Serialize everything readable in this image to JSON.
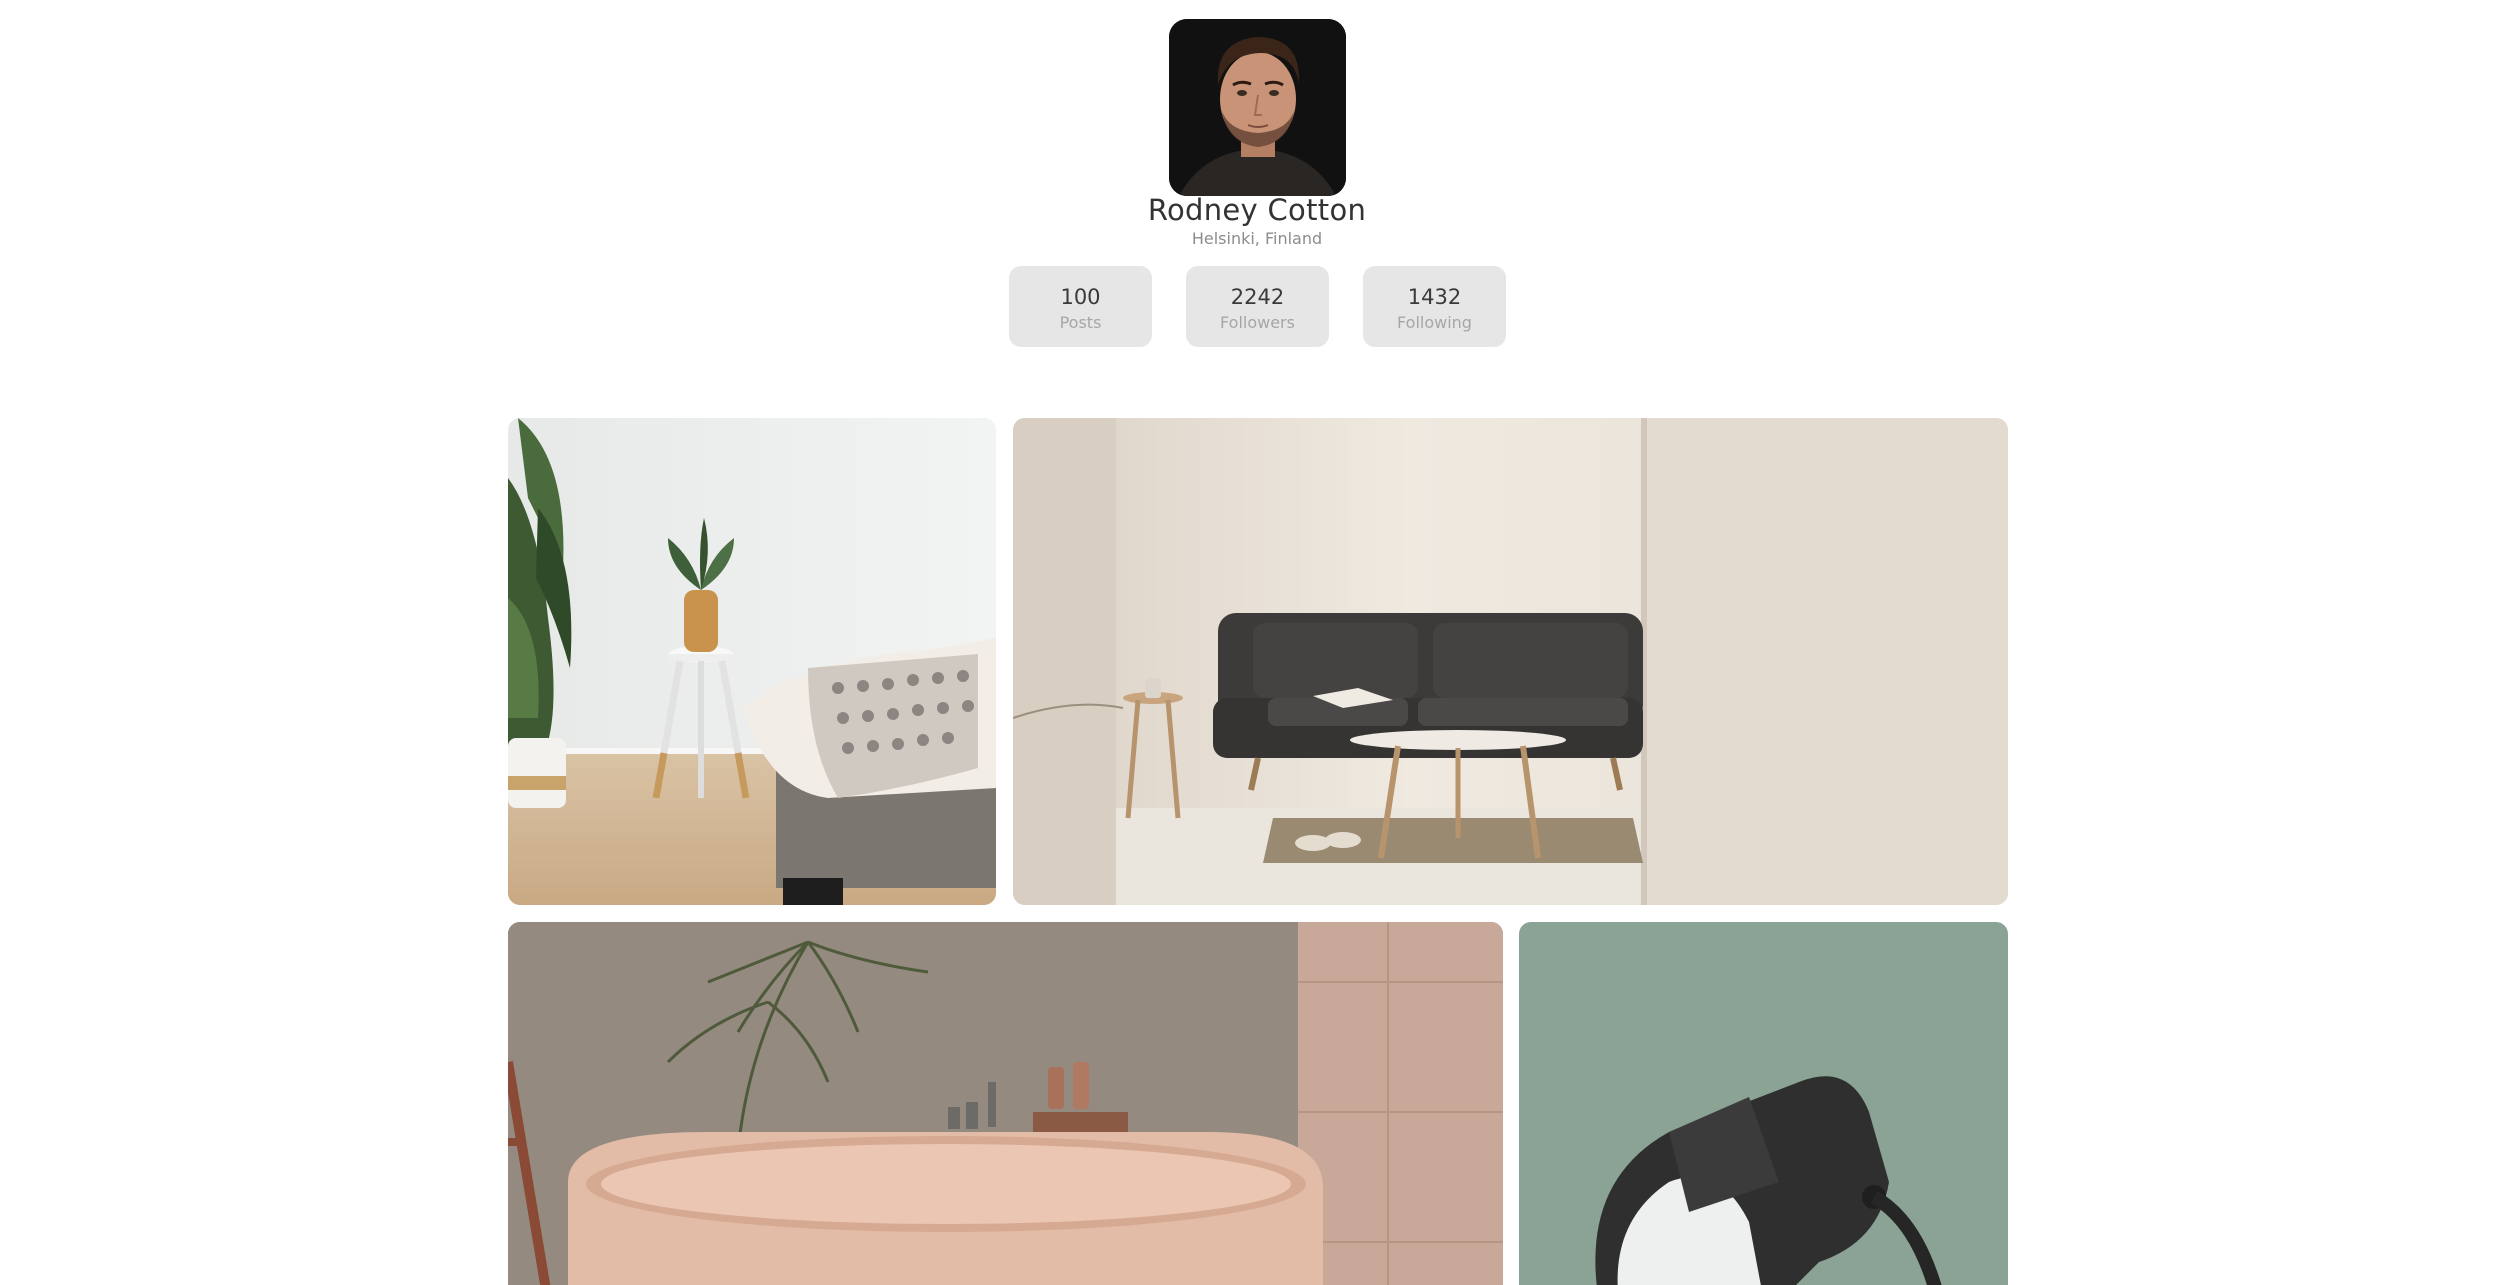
{
  "profile": {
    "name": "Rodney Cotton",
    "location": "Helsinki, Finland"
  },
  "stats": [
    {
      "value": "100",
      "label": "Posts"
    },
    {
      "value": "2242",
      "label": "Followers"
    },
    {
      "value": "1432",
      "label": "Following"
    }
  ],
  "gallery": {
    "photos": [
      {
        "subject": "bedroom-side-table-plant"
      },
      {
        "subject": "living-room-grey-sofa"
      },
      {
        "subject": "bathroom-pink-bathtub"
      },
      {
        "subject": "black-desk-lamp-green-wall"
      }
    ]
  },
  "colors": {
    "stat_background": "#e6e6e6",
    "name_text": "#333333",
    "muted_text": "#8c8c8c"
  }
}
